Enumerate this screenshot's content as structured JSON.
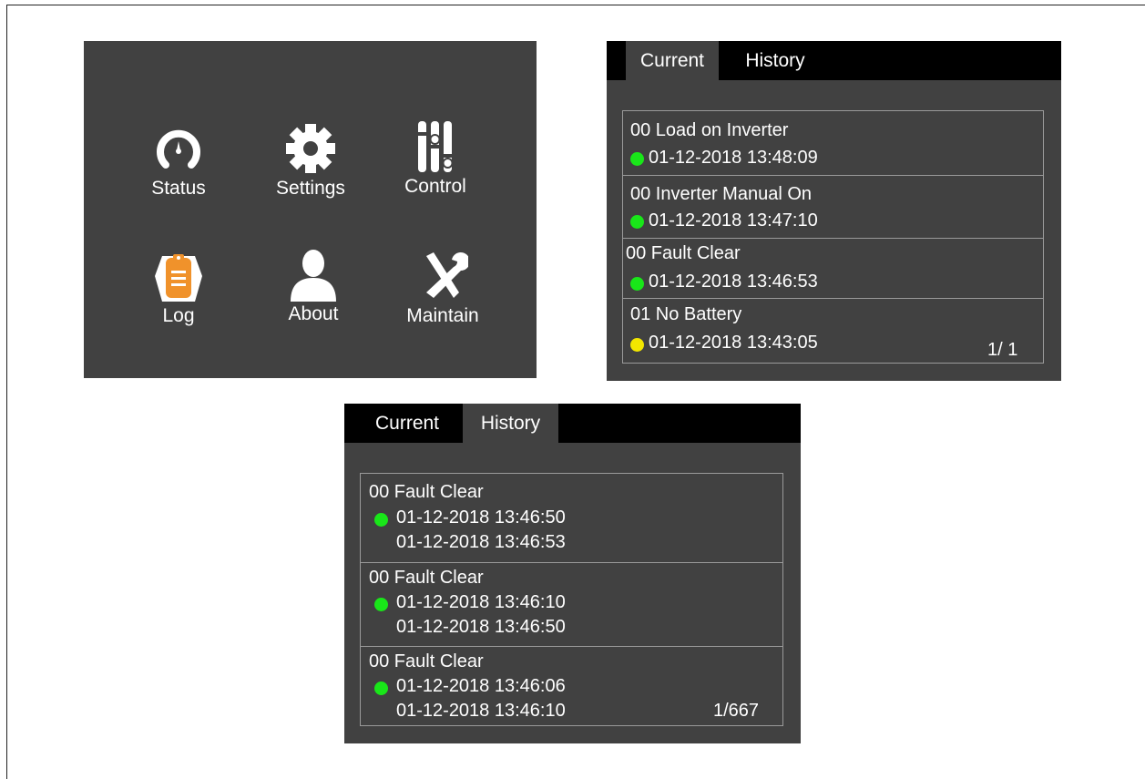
{
  "menu": {
    "items": [
      {
        "label": "Status",
        "icon": "gauge-icon"
      },
      {
        "label": "Settings",
        "icon": "gear-icon"
      },
      {
        "label": "Control",
        "icon": "sliders-icon"
      },
      {
        "label": "Log",
        "icon": "clipboard-icon"
      },
      {
        "label": "About",
        "icon": "user-icon"
      },
      {
        "label": "Maintain",
        "icon": "tools-icon"
      }
    ]
  },
  "current_panel": {
    "tabs": {
      "current": "Current",
      "history": "History"
    },
    "active_tab": "Current",
    "entries": [
      {
        "title": "00 Load on Inverter",
        "time": "01-12-2018 13:48:09",
        "status_color": "#19e619"
      },
      {
        "title": "00 Inverter Manual On",
        "time": "01-12-2018 13:47:10",
        "status_color": "#19e619"
      },
      {
        "title": "00 Fault Clear",
        "time": "01-12-2018 13:46:53",
        "status_color": "#19e619"
      },
      {
        "title": "01 No Battery",
        "time": "01-12-2018 13:43:05",
        "status_color": "#f2e600"
      }
    ],
    "page": "1/ 1"
  },
  "history_panel": {
    "tabs": {
      "current": "Current",
      "history": "History"
    },
    "active_tab": "History",
    "entries": [
      {
        "title": "00 Fault Clear",
        "start": "01-12-2018 13:46:50",
        "end": "01-12-2018 13:46:53",
        "status_color": "#19e619"
      },
      {
        "title": "00 Fault Clear",
        "start": "01-12-2018 13:46:10",
        "end": "01-12-2018 13:46:50",
        "status_color": "#19e619"
      },
      {
        "title": "00 Fault Clear",
        "start": "01-12-2018 13:46:06",
        "end": "01-12-2018 13:46:10",
        "status_color": "#19e619"
      }
    ],
    "page": "1/667"
  },
  "colors": {
    "panel_bg": "#414141",
    "tabbar_bg": "#000000",
    "log_icon_orange": "#f0922b"
  }
}
